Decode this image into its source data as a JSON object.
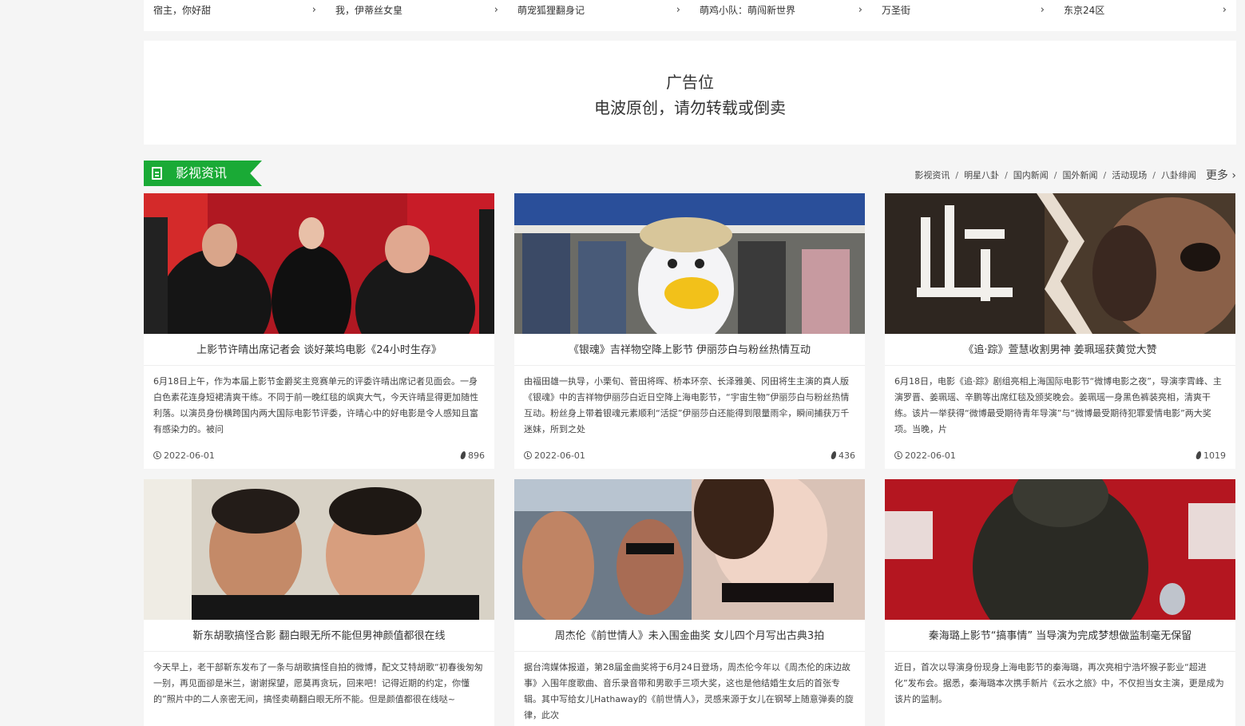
{
  "top_links": [
    "宿主，你好甜",
    "我，伊蒂丝女皇",
    "萌宠狐狸翻身记",
    "萌鸡小队：萌闯新世界",
    "万圣街",
    "东京24区"
  ],
  "ad": {
    "line1": "广告位",
    "line2": "电波原创，请勿转载或倒卖"
  },
  "section": {
    "title": "影视资讯",
    "nav": [
      "影视资讯",
      "明星八卦",
      "国内新闻",
      "国外新闻",
      "活动现场",
      "八卦绯闻"
    ],
    "separator": "/",
    "more": "更多"
  },
  "cards": [
    {
      "title": "上影节许晴出席记者会 谈好莱坞电影《24小时生存》",
      "desc": "6月18日上午，作为本届上影节金爵奖主竞赛单元的评委许晴出席记者见面会。一身白色素花连身短裙清爽干练。不同于前一晚红毯的飒爽大气，今天许晴显得更加随性利落。以演员身份横跨国内两大国际电影节评委，许晴心中的好电影是令人感知且富有感染力的。被问",
      "date": "2022-06-01",
      "views": "896"
    },
    {
      "title": "《银魂》吉祥物空降上影节 伊丽莎白与粉丝热情互动",
      "desc": "由福田雄一执导，小栗旬、菅田将晖、桥本环奈、长泽雅美、冈田将生主演的真人版《银魂》中的吉祥物伊丽莎白近日空降上海电影节，“宇宙生物”伊丽莎白与粉丝热情互动。粉丝身上带着银魂元素顺利“活捉”伊丽莎白还能得到限量雨伞，瞬间捕获万千迷妹，所到之处",
      "date": "2022-06-01",
      "views": "436"
    },
    {
      "title": "《追·踪》萱慧收割男神 姜珮瑶获黄觉大赞",
      "desc": "6月18日，电影《追·踪》剧组亮相上海国际电影节“微博电影之夜”，导演李霄峰、主演罗晋、姜珮瑶、辛鹏等出席红毯及颁奖晚会。姜珮瑶一身黑色裤装亮相，清爽干练。该片一举获得“微博最受期待青年导演”与“微博最受期待犯罪爱情电影”两大奖项。当晚，片",
      "date": "2022-06-01",
      "views": "1019"
    },
    {
      "title": "靳东胡歌搞怪合影 翻白眼无所不能但男神颜值都很在线",
      "desc": "今天早上，老干部靳东发布了一条与胡歌搞怪自拍的微博，配文艾特胡歌“初春後匆匆一别，再见面卻是米兰，谢谢探望，愿莫再贪玩，回来吧！记得近期的约定，你懂的”照片中的二人亲密无间，搞怪卖萌翻白眼无所不能。但是颜值都很在线哒~",
      "date": "",
      "views": ""
    },
    {
      "title": "周杰伦《前世情人》未入围金曲奖 女儿四个月写出古典3拍",
      "desc": "据台湾媒体报道，第28届金曲奖将于6月24日登场，周杰伦今年以《周杰伦的床边故事》入围年度歌曲、音乐录音带和男歌手三项大奖，这也是他结婚生女后的首张专辑。其中写给女儿Hathaway的《前世情人》，灵感来源于女儿在钢琴上随意弹奏的旋律，此次",
      "date": "",
      "views": ""
    },
    {
      "title": "秦海璐上影节“搞事情” 当导演为完成梦想做监制毫无保留",
      "desc": "近日，首次以导演身份现身上海电影节的秦海璐，再次亮相宁浩坏猴子影业“超进化”发布会。据悉，秦海璐本次携手新片《云水之旅》中，不仅担当女主演，更是成为该片的监制。",
      "date": "",
      "views": ""
    }
  ]
}
